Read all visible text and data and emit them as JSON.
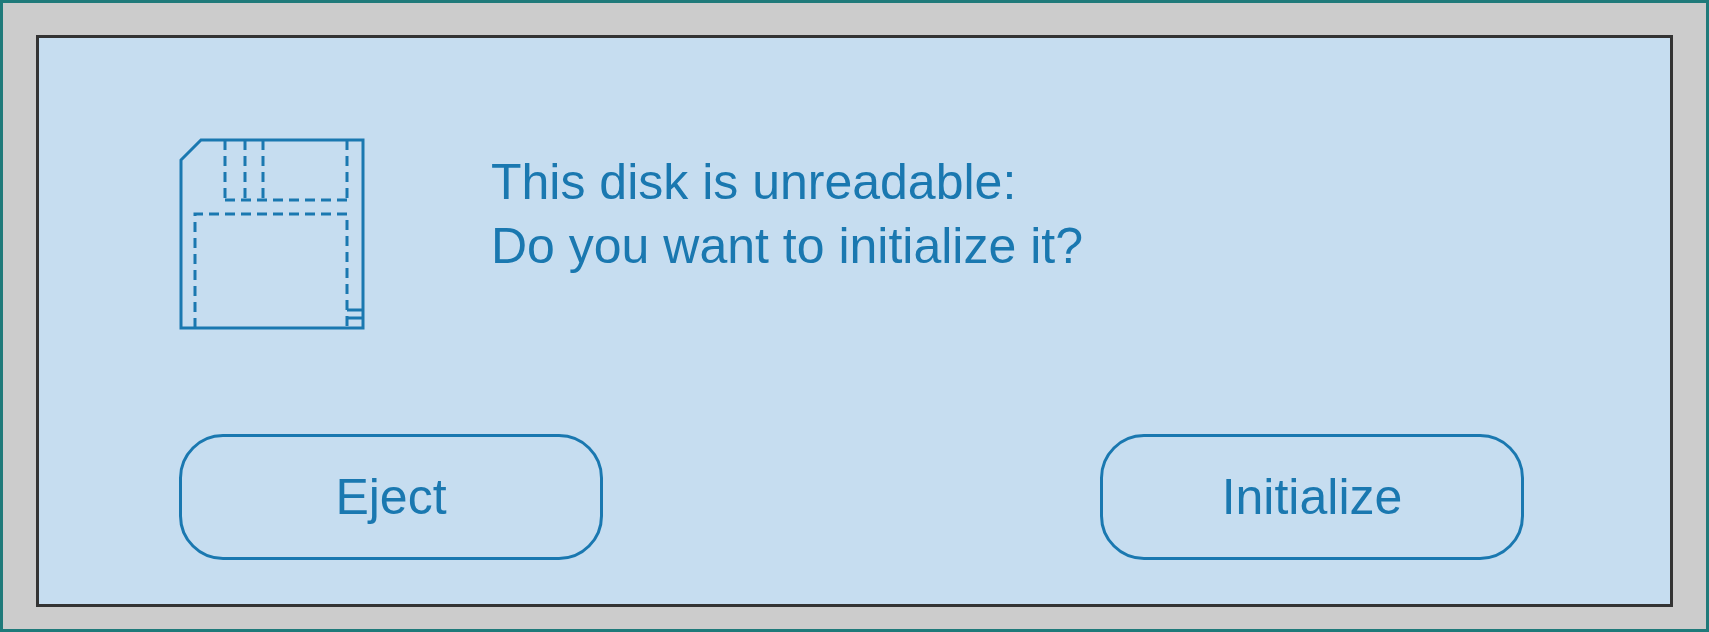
{
  "message": [
    "This disk is unreadable:",
    "Do you want to initialize it?"
  ],
  "buttons": [
    "Eject",
    "Initialize"
  ]
}
